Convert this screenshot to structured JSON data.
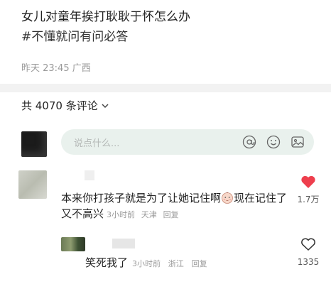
{
  "post": {
    "title": "女儿对童年挨打耿耿于怀怎么办",
    "hashtag": "#不懂就问有问必答",
    "meta": "昨天 23:45 广西"
  },
  "comments_header": {
    "count_text": "共 4070 条评论",
    "chevron_icon": "chevron-down-icon"
  },
  "input": {
    "placeholder": "说点什么...",
    "icons": [
      "at-icon",
      "smile-icon",
      "image-icon"
    ]
  },
  "comments": [
    {
      "text_part1": "本来你打孩子就是为了让她记住啊",
      "emoji": "baby-face-emoji",
      "text_part2": "现在记住了又不高兴",
      "time": "3小时前",
      "location": "天津",
      "reply_label": "回复",
      "likes": "1.7万",
      "liked": true,
      "like_color": "#ee3f4d"
    },
    {
      "text": "笑死我了",
      "time": "3小时前",
      "location": "浙江",
      "reply_label": "回复",
      "likes": "1335",
      "liked": false
    }
  ]
}
